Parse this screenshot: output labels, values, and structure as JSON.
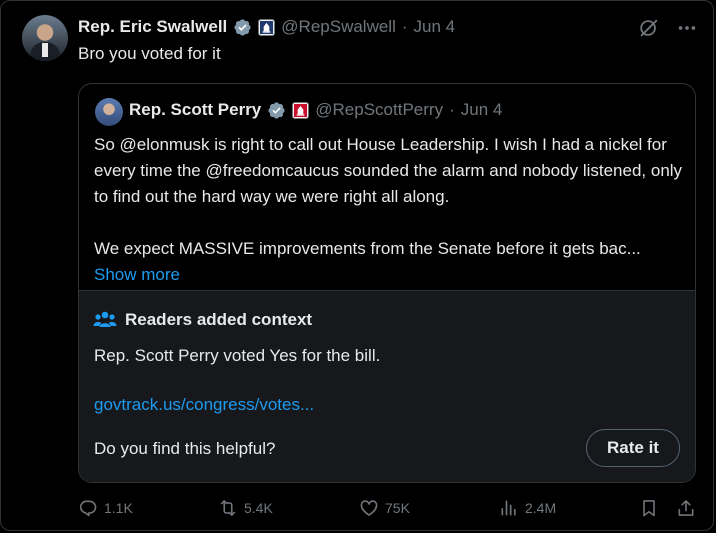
{
  "tweet": {
    "display_name": "Rep. Eric Swalwell",
    "handle": "@RepSwalwell",
    "separator": "·",
    "date": "Jun 4",
    "text": "Bro you voted for it"
  },
  "quoted_tweet": {
    "display_name": "Rep. Scott Perry",
    "handle": "@RepScottPerry",
    "separator": "·",
    "date": "Jun 4",
    "paragraph_1": "So @elonmusk is right to call out House Leadership.  I wish I had a nickel for every time the @freedomcaucus sounded the alarm and nobody listened, only to find out the hard way we were right all along.",
    "paragraph_2": "We expect MASSIVE improvements from the Senate before it gets bac...",
    "show_more": "Show more"
  },
  "community_note": {
    "title": "Readers added context",
    "body": "Rep. Scott Perry voted Yes for the bill.",
    "link": "govtrack.us/congress/votes...",
    "question": "Do you find this helpful?",
    "rate_button": "Rate it"
  },
  "actions": {
    "replies": "1.1K",
    "reposts": "5.4K",
    "likes": "75K",
    "views": "2.4M"
  },
  "colors": {
    "background": "#000000",
    "text": "#e7e9ea",
    "muted": "#71767b",
    "link": "#1d9bf0",
    "verified": "#829aab",
    "note_background": "#16181c"
  },
  "icons": [
    "verified-badge-icon",
    "government-affiliation-icon",
    "grok-icon",
    "more-icon",
    "community-notes-icon",
    "reply-icon",
    "repost-icon",
    "like-icon",
    "views-icon",
    "bookmark-icon",
    "share-icon"
  ]
}
